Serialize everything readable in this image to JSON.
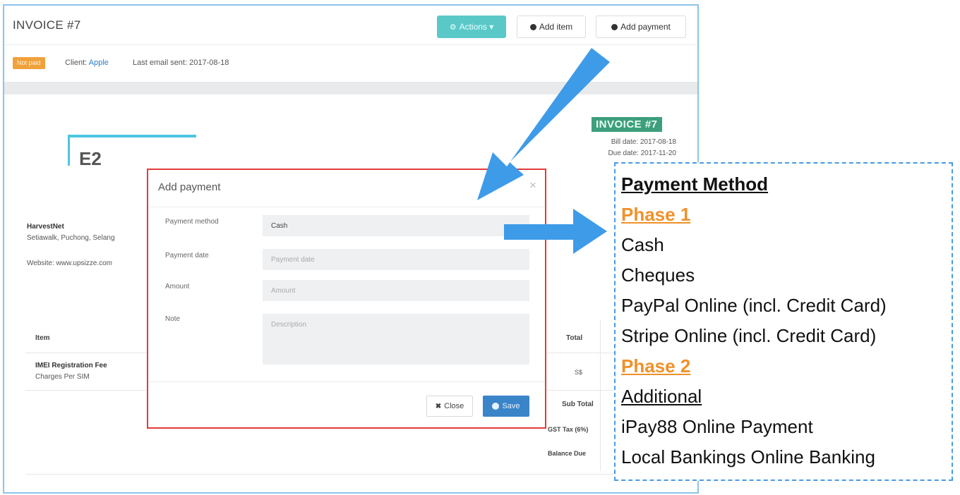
{
  "app": {
    "title": "INVOICE #7",
    "toolbar": {
      "actions_label": "Actions ▾",
      "add_item_label": "Add item",
      "add_payment_label": "Add payment"
    },
    "status": {
      "badge": "Not paid",
      "client_label": "Client:",
      "client_name": "Apple",
      "last_email": "Last email sent: 2017-08-18"
    }
  },
  "invoice": {
    "logo_text": "E2",
    "badge": "INVOICE #7",
    "bill_date": "Bill date: 2017-08-18",
    "due_date": "Due date: 2017-11-20",
    "company": {
      "name": "HarvestNet",
      "address": "Setiawalk, Puchong, Selang",
      "website": "Website: www.upsizze.com"
    },
    "table": {
      "col_item": "Item",
      "col_total": "Total",
      "rows": [
        {
          "name": "IMEI Registration Fee",
          "desc": "Charges Per SIM",
          "total": "S$"
        }
      ],
      "sub_total_label": "Sub Total",
      "gst_label": "GST Tax (6%)",
      "balance_label": "Balance Due"
    }
  },
  "modal": {
    "title": "Add payment",
    "close_icon": "×",
    "fields": {
      "payment_method_label": "Payment method",
      "payment_method_value": "Cash",
      "payment_date_label": "Payment date",
      "payment_date_placeholder": "Payment date",
      "amount_label": "Amount",
      "amount_placeholder": "Amount",
      "note_label": "Note",
      "note_placeholder": "Description"
    },
    "close_button": "Close",
    "save_button": "Save"
  },
  "payment_methods": {
    "heading": "Payment Method",
    "phase1": "Phase 1",
    "phase1_items": [
      "Cash",
      "Cheques",
      "PayPal Online (incl. Credit Card)",
      "Stripe Online (incl. Credit Card)"
    ],
    "phase2": "Phase 2",
    "additional": "Additional",
    "phase2_items": [
      "iPay88 Online Payment",
      "Local Bankings Online Banking"
    ]
  },
  "colors": {
    "actions_button": "#5bc8c8",
    "not_paid_badge": "#f0a13a",
    "invoice_badge": "#3d9f7c",
    "modal_border": "#e23a3a",
    "save_button": "#3a84c8",
    "arrow": "#3e9be8",
    "phase_text": "#f0912a",
    "panel_border": "#4a9ae6"
  }
}
